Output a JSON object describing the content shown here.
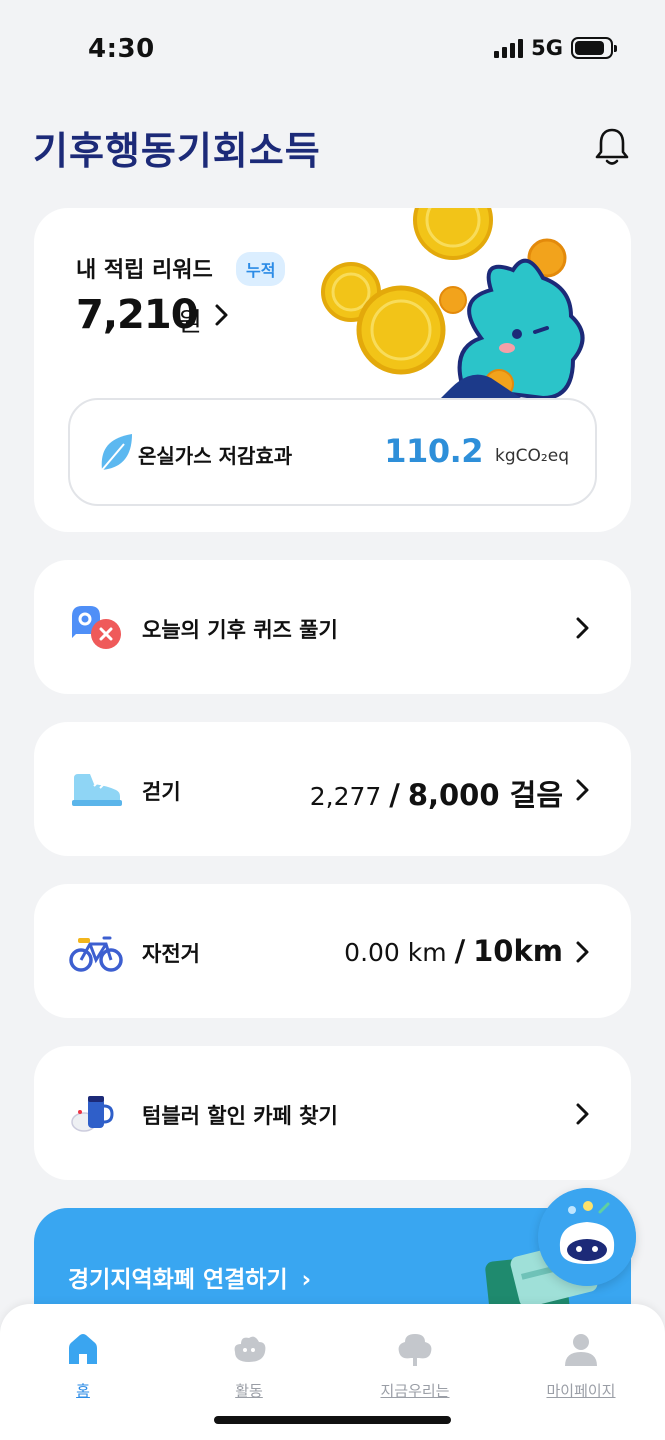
{
  "status_bar": {
    "time": "4:30",
    "network": "5G",
    "battery_level": 0.85
  },
  "header": {
    "logo_text": "기후행동기회소득",
    "notification_icon": "bell-icon"
  },
  "reward": {
    "title": "내 적립 리워드",
    "badge": "누적",
    "amount": "7,210",
    "unit": "원",
    "ghg_label": "온실가스 저감효과",
    "ghg_value": "110.2",
    "ghg_unit": "kgCO₂eq"
  },
  "rows": [
    {
      "icon": "quiz-icon",
      "label": "오늘의 기후 퀴즈 풀기"
    },
    {
      "icon": "shoe-icon",
      "label": "걷기",
      "current": "2,277",
      "target": "8,000 걸음"
    },
    {
      "icon": "bicycle-icon",
      "label": "자전거",
      "current": "0.00 km",
      "target": "10km"
    },
    {
      "icon": "tumbler-icon",
      "label": "텀블러 할인 카페 찾기"
    }
  ],
  "separator": "/",
  "gg_banner": {
    "label": "경기지역화폐 연결하기"
  },
  "bottom_nav": [
    {
      "label": "홈",
      "icon": "home-icon",
      "active": true
    },
    {
      "label": "활동",
      "icon": "activity-icon",
      "active": false
    },
    {
      "label": "지금우리는",
      "icon": "tree-icon",
      "active": false
    },
    {
      "label": "마이페이지",
      "icon": "user-icon",
      "active": false
    }
  ],
  "colors": {
    "accent": "#2b8be6",
    "brand_navy": "#1c2a78",
    "banner": "#39a6f1",
    "ghg_value": "#2e8fd9"
  }
}
